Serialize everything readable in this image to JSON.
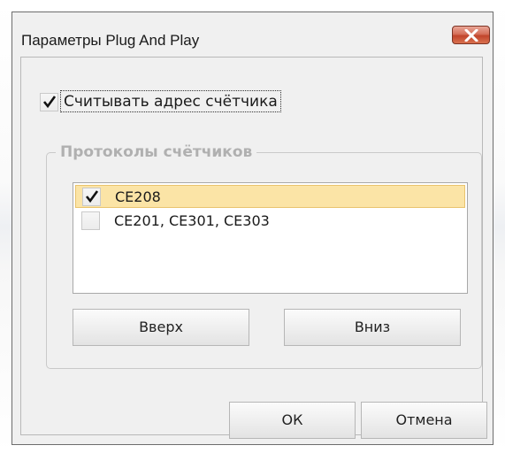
{
  "window": {
    "title": "Параметры Plug And Play"
  },
  "read_address": {
    "label": "Считывать адрес счётчика",
    "checked": true
  },
  "protocols": {
    "group_title": "Протоколы счётчиков",
    "items": [
      {
        "label": "CE208",
        "checked": true,
        "selected": true
      },
      {
        "label": "CE201, CE301, CE303",
        "checked": false,
        "selected": false
      }
    ],
    "up_label": "Вверх",
    "down_label": "Вниз"
  },
  "buttons": {
    "ok_label": "ОК",
    "cancel_label": "Отмена"
  },
  "icons": {
    "close": "close-icon",
    "check": "checkmark-icon"
  },
  "colors": {
    "selection": "#fbe4a6",
    "close_button": "#c1442b"
  }
}
